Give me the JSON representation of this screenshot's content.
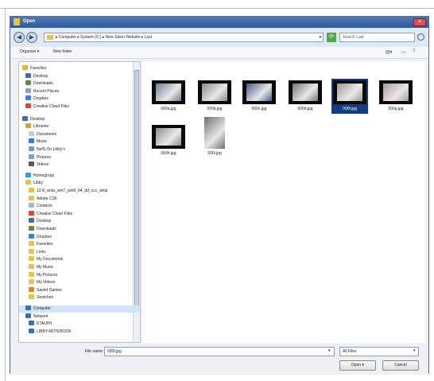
{
  "window": {
    "title": "Open"
  },
  "address": {
    "path": "▸ Computer ▸ System (C:) ▸ New Salon Website ▸ Last",
    "search_placeholder": "Search Last"
  },
  "toolbar": {
    "organize": "Organize ▾",
    "new_folder": "New folder"
  },
  "nav": {
    "items": [
      {
        "label": "Favorites",
        "icon": "star-icon",
        "color": "#e9b530"
      },
      {
        "label": "Desktop",
        "icon": "desktop-icon",
        "color": "#3d6fb4"
      },
      {
        "label": "Downloads",
        "icon": "downloads-icon",
        "color": "#6a8a3a"
      },
      {
        "label": "Recent Places",
        "icon": "recent-places-icon",
        "color": "#8da4c2"
      },
      {
        "label": "Dropbox",
        "icon": "dropbox-icon",
        "color": "#3b82d6"
      },
      {
        "label": "Creative Cloud Files",
        "icon": "creative-cloud-icon",
        "color": "#d84a38"
      },
      {
        "label": "Desktop",
        "icon": "desktop-icon",
        "color": "#3d6fb4"
      },
      {
        "label": "Libraries",
        "icon": "library-icon",
        "color": "#c9a640"
      },
      {
        "label": "Documents",
        "icon": "documents-icon",
        "color": "#c8ced6"
      },
      {
        "label": "Music",
        "icon": "music-icon",
        "color": "#3d7bc4"
      },
      {
        "label": "NefS On Libby's",
        "icon": "network-folder-icon",
        "color": "#6aa2c9"
      },
      {
        "label": "Pictures",
        "icon": "pictures-icon",
        "color": "#7fa0c0"
      },
      {
        "label": "Videos",
        "icon": "videos-icon",
        "color": "#555a63"
      },
      {
        "label": "Homegroup",
        "icon": "homegroup-icon",
        "color": "#3a9ad9"
      },
      {
        "label": "Libby",
        "icon": "user-folder-icon",
        "color": "#e4c152"
      },
      {
        "label": "12-8_vista_win7_win8_64_dd_ccc_whql",
        "icon": "folder-icon",
        "color": "#e4c152"
      },
      {
        "label": "Adobe CS6",
        "icon": "folder-icon",
        "color": "#e4c152"
      },
      {
        "label": "Contacts",
        "icon": "contacts-icon",
        "color": "#a8b6c4"
      },
      {
        "label": "Creative Cloud Files",
        "icon": "creative-cloud-icon",
        "color": "#d84a38"
      },
      {
        "label": "Desktop",
        "icon": "desktop-icon",
        "color": "#3d6fb4"
      },
      {
        "label": "Downloads",
        "icon": "downloads-icon",
        "color": "#6a8a3a"
      },
      {
        "label": "Dropbox",
        "icon": "dropbox-icon",
        "color": "#3b82d6"
      },
      {
        "label": "Favorites",
        "icon": "favorites-folder-icon",
        "color": "#e4c152"
      },
      {
        "label": "Links",
        "icon": "links-icon",
        "color": "#e4c152"
      },
      {
        "label": "My Documents",
        "icon": "folder-icon",
        "color": "#e4c152"
      },
      {
        "label": "My Music",
        "icon": "folder-icon",
        "color": "#e4c152"
      },
      {
        "label": "My Pictures",
        "icon": "folder-icon",
        "color": "#e4c152"
      },
      {
        "label": "My Videos",
        "icon": "folder-icon",
        "color": "#e4c152"
      },
      {
        "label": "Saved Games",
        "icon": "saved-games-icon",
        "color": "#c98b2e"
      },
      {
        "label": "Searches",
        "icon": "searches-icon",
        "color": "#e4c152"
      },
      {
        "label": "Computer",
        "icon": "computer-icon",
        "color": "#3d6fb4",
        "selected": true
      },
      {
        "label": "Network",
        "icon": "network-icon",
        "color": "#3d6fb4"
      },
      {
        "label": "ETALBH",
        "icon": "network-computer-icon",
        "color": "#3d6fb4"
      },
      {
        "label": "LIBBY-NOTEBOOK",
        "icon": "network-computer-icon",
        "color": "#3d6fb4"
      }
    ]
  },
  "files": [
    {
      "name": "000a.jpg",
      "tone": "#6d7f93",
      "selected": false
    },
    {
      "name": "000b.jpg",
      "tone": "#8b8b86",
      "selected": false
    },
    {
      "name": "000c.jpg",
      "tone": "#4a5a86",
      "selected": false
    },
    {
      "name": "000d.jpg",
      "tone": "#7a7478",
      "selected": false
    },
    {
      "name": "000f.jpg",
      "tone": "#9c9c94",
      "selected": true
    },
    {
      "name": "000g.jpg",
      "tone": "#a49e96",
      "selected": false
    },
    {
      "name": "000h.jpg",
      "tone": "#8c8c8c",
      "selected": false
    },
    {
      "name": "000i.jpg",
      "tone": "#6f6f6f",
      "selected": false
    }
  ],
  "footer": {
    "file_name_label": "File name:",
    "file_name_value": "000f.jpg",
    "filter": "All Files",
    "open": "Open",
    "cancel": "Cancel"
  }
}
